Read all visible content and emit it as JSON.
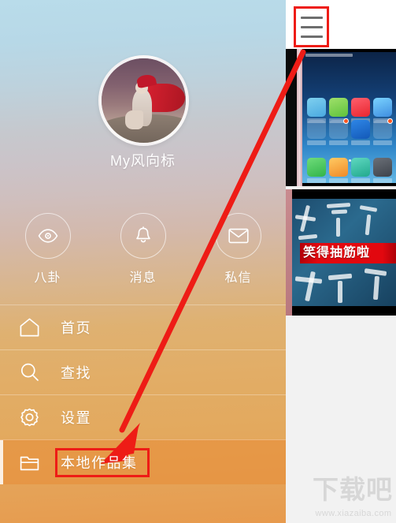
{
  "drawer": {
    "profile": {
      "avatar_name": "avatar",
      "username": "My风向标"
    },
    "quick_actions": [
      {
        "label": "八卦",
        "icon": "eye-icon"
      },
      {
        "label": "消息",
        "icon": "bell-icon"
      },
      {
        "label": "私信",
        "icon": "envelope-icon"
      }
    ],
    "menu_items": [
      {
        "label": "首页",
        "icon": "home-icon",
        "active": false
      },
      {
        "label": "查找",
        "icon": "search-icon",
        "active": false
      },
      {
        "label": "设置",
        "icon": "gear-icon",
        "active": false
      },
      {
        "label": "本地作品集",
        "icon": "folder-icon",
        "active": true
      }
    ]
  },
  "right_panel": {
    "hamburger": {
      "name": "menu-button",
      "lines": 3
    },
    "thumbnails": [
      {
        "name": "phone-home-screen-thumbnail",
        "kind": "image"
      },
      {
        "name": "video-thumbnail",
        "kind": "video",
        "caption": "笑得抽筋啦"
      }
    ]
  },
  "watermark": {
    "logo_text": "下载吧",
    "url": "www.xiazaiba.com"
  },
  "annotations": {
    "arrow_color": "#ee1c16",
    "box_color": "#ee1c16",
    "arrow_from": "menu-button",
    "arrow_to": "本地作品集"
  },
  "colors": {
    "gradient_top": "#b9dcea",
    "gradient_mid": "#c9c5cc",
    "gradient_bottom": "#e79a4d",
    "accent_red": "#ee1c16",
    "text_white": "#ffffff"
  }
}
